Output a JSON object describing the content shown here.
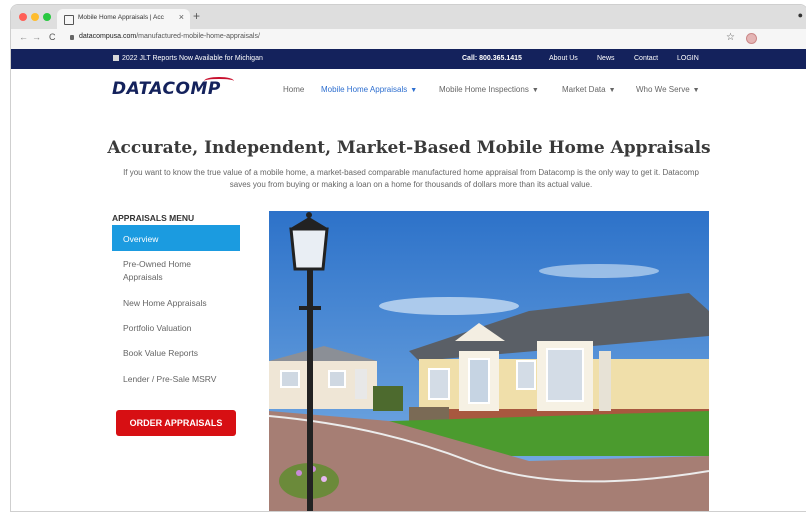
{
  "browser": {
    "tab_title": "Mobile Home Appraisals | Acc",
    "tab_close": "×",
    "new_tab": "+",
    "url_domain": "datacompusa.com",
    "url_path": "/manufactured-mobile-home-appraisals/",
    "back": "←",
    "forward": "→",
    "reload": "C",
    "star": "☆",
    "dots_colors": [
      "#ff5f57",
      "#febc2e",
      "#28c840"
    ]
  },
  "topbar": {
    "notice": "2022 JLT Reports Now Available for Michigan",
    "call": "Call: 800.365.1415",
    "links": [
      "About Us",
      "News",
      "Contact",
      "LOGIN"
    ]
  },
  "nav": {
    "logo": "DATACOMP",
    "items": [
      {
        "label": "Home",
        "dropdown": false
      },
      {
        "label": "Mobile Home Appraisals",
        "dropdown": true,
        "active": true
      },
      {
        "label": "Mobile Home Inspections",
        "dropdown": true
      },
      {
        "label": "Market Data",
        "dropdown": true
      },
      {
        "label": "Who We Serve",
        "dropdown": true
      }
    ],
    "chevron": "⌄"
  },
  "hero": {
    "headline": "Accurate, Independent, Market-Based Mobile Home Appraisals",
    "subtext": "If you want to know the true value of a mobile home, a market-based comparable manufactured home appraisal from Datacomp is the only way to get it. Datacomp saves you from buying or making a loan on a home for thousands of dollars more than its actual value."
  },
  "sidebar": {
    "title": "APPRAISALS MENU",
    "items": [
      {
        "label": "Overview",
        "active": true
      },
      {
        "label": "Pre-Owned Home Appraisals"
      },
      {
        "label": "New Home Appraisals"
      },
      {
        "label": "Portfolio Valuation"
      },
      {
        "label": "Book Value Reports"
      },
      {
        "label": "Lender / Pre-Sale MSRV"
      }
    ],
    "order_button": "ORDER APPRAISALS"
  },
  "colors": {
    "brand_navy": "#14225c",
    "accent_blue": "#1b9be0",
    "active_link": "#2e6fd0",
    "order_red": "#d70f13"
  }
}
